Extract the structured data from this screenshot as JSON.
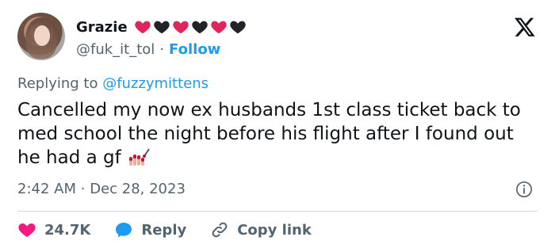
{
  "user": {
    "name": "Grazie",
    "handle": "@fuk_it_tol",
    "separator": "·",
    "follow_label": "Follow",
    "heart_colors": [
      "#e0245e",
      "#202327",
      "#e0245e",
      "#202327",
      "#e0245e",
      "#202327"
    ]
  },
  "reply_context": {
    "prefix": "Replying to",
    "mention": "@fuzzymittens"
  },
  "tweet": {
    "text": "Cancelled my now ex husbands 1st class ticket back to med school the night before his flight after I found out he had a gf",
    "emoji": "nail-polish-emoji",
    "time": "2:42 AM",
    "separator": "·",
    "date": "Dec 28, 2023"
  },
  "actions": {
    "like_count": "24.7K",
    "reply_label": "Reply",
    "copy_label": "Copy link"
  },
  "colors": {
    "accent": "#1d9bf0",
    "like": "#f91880",
    "text": "#0f1419",
    "muted": "#536471"
  }
}
